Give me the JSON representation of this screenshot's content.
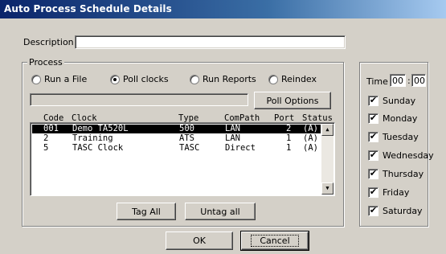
{
  "window": {
    "title": "Auto Process Schedule Details"
  },
  "description": {
    "label": "Description",
    "value": ""
  },
  "process": {
    "legend": "Process",
    "options": [
      {
        "label": "Run a File",
        "selected": false
      },
      {
        "label": "Poll clocks",
        "selected": true
      },
      {
        "label": "Run Reports",
        "selected": false
      },
      {
        "label": "Reindex",
        "selected": false
      }
    ],
    "status_text": "",
    "poll_options_label": "Poll Options",
    "columns": [
      "Code",
      "Clock",
      "Type",
      "ComPath",
      "Port",
      "Status"
    ],
    "rows": [
      {
        "code": "001",
        "clock": "Demo TA520L",
        "type": "500",
        "compath": "LAN",
        "port": "2",
        "status": "(A)",
        "selected": true
      },
      {
        "code": "2",
        "clock": "Training",
        "type": "ATS",
        "compath": "LAN",
        "port": "1",
        "status": "(A)",
        "selected": false
      },
      {
        "code": "5",
        "clock": "TASC Clock",
        "type": "TASC",
        "compath": "Direct",
        "port": "1",
        "status": "(A)",
        "selected": false
      }
    ],
    "tag_all_label": "Tag All",
    "untag_all_label": "Untag all"
  },
  "time": {
    "label": "Time",
    "hours": "00",
    "separator": ":",
    "minutes": "00"
  },
  "days": [
    {
      "label": "Sunday",
      "checked": true
    },
    {
      "label": "Monday",
      "checked": true
    },
    {
      "label": "Tuesday",
      "checked": true
    },
    {
      "label": "Wednesday",
      "checked": true
    },
    {
      "label": "Thursday",
      "checked": true
    },
    {
      "label": "Friday",
      "checked": true
    },
    {
      "label": "Saturday",
      "checked": true
    }
  ],
  "buttons": {
    "ok": "OK",
    "cancel": "Cancel"
  },
  "icons": {
    "check": "✔",
    "scroll_up": "▲",
    "scroll_down": "▼"
  },
  "colors": {
    "titlebar_start": "#0a246a",
    "titlebar_end": "#a6caf0",
    "selection": "#000000",
    "face": "#d4d0c8"
  }
}
